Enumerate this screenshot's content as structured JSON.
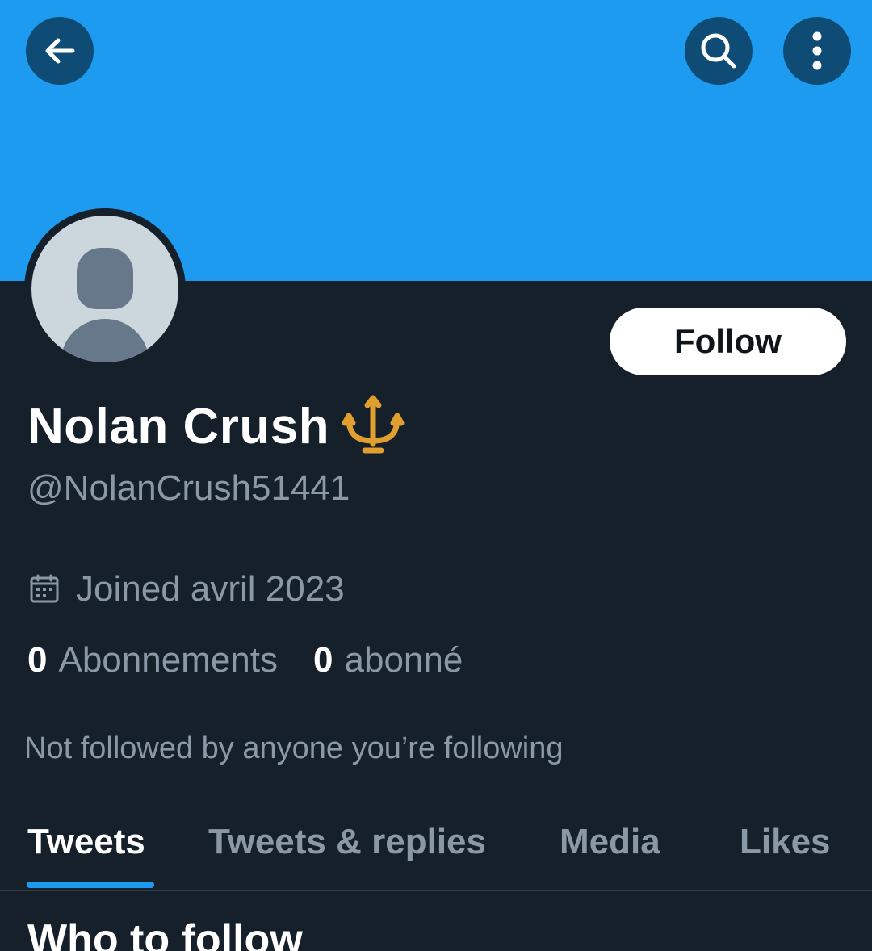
{
  "profile": {
    "name": "Nolan Crush",
    "name_emoji": "trident-emblem",
    "handle": "@NolanCrush51441",
    "joined": "Joined avril 2023",
    "following_count": "0",
    "following_label": "Abonnements",
    "followers_count": "0",
    "followers_label": "abonné",
    "not_followed_text": "Not followed by anyone you’re following"
  },
  "header": {
    "back_icon": "arrow-left-icon",
    "search_icon": "search-icon",
    "more_icon": "more-vertical-icon",
    "banner_color": "#1d9bf0"
  },
  "actions": {
    "follow_label": "Follow"
  },
  "tabs": [
    {
      "label": "Tweets",
      "active": true
    },
    {
      "label": "Tweets & replies",
      "active": false
    },
    {
      "label": "Media",
      "active": false
    },
    {
      "label": "Likes",
      "active": false
    }
  ],
  "sections": {
    "who_to_follow": "Who to follow"
  },
  "colors": {
    "background": "#15202b",
    "accent": "#1d9bf0",
    "secondary_text": "#8b98a5"
  }
}
